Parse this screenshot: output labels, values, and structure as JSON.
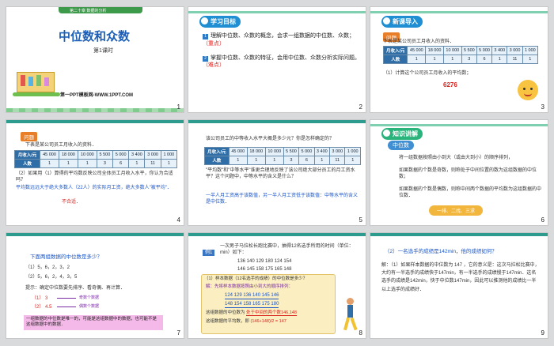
{
  "slides": [
    {
      "num": "1",
      "banner": "第二十章 数据的分析",
      "title": "中位数和众数",
      "sub": "第1课时",
      "footer": "第一PPT模板网-WWW.1PPT.COM"
    },
    {
      "num": "2",
      "heading": "学习目标",
      "goal1_a": "理解中位数、众数的概念，会求一组数据的中位数、众数；",
      "goal1_b": "（重点）",
      "goal2_a": "掌握中位数、众数的特征，会用中位数、众数分析实际问题。",
      "goal2_b": "（难点）"
    },
    {
      "num": "3",
      "heading": "新课导入",
      "tag": "问题",
      "intro": "下表是某公司员工月收入的资料．",
      "q": "（1）计算这个公司员工月收入的平均数；",
      "answer": "6276"
    },
    {
      "num": "4",
      "tag": "问题",
      "intro": "下表是某公司员工月收入的资料．",
      "q2": "（2）如果用（1）算得的平均数反映公司全体员工月收入水平，你认为合适吗？",
      "a2": "平均数远远大于绝大多数人（22人）的实际月工资，绝大多数人\"被平均\"．",
      "a2b": "不合适．"
    },
    {
      "num": "5",
      "q": "该公司员工的中等收入水平大概是多少元？你是怎样确定的？",
      "p1": "\"平均数\"和\"中等水平\"谁更合理地反映了该公司绝大部分员工的月工资水平？这个问题中，中等水平的含义是什么？",
      "p2": "一半人月工资高于该数值，另一半人月工资低于该数值：中等水平的含义是中位数．"
    },
    {
      "num": "6",
      "heading": "知识讲解",
      "sub": "中位数",
      "l1": "将一组数据按照由小到大（或由大到小）的顺序排列，",
      "l2": "如果数据的个数是奇数，则称处于中间位置的数为这组数据的中位数；",
      "l3": "如果数据的个数是偶数，则称中间两个数据的平均数为这组数据的中位数．",
      "pill": "一排、二找、三求"
    },
    {
      "num": "7",
      "head": "下面两组数据的中位数是多少？",
      "d1": "（1）5，6，2，3，2",
      "d2": "（2）5，6，2，4，3，5",
      "tip": "提示：确定中位数要先排序、看奇偶、再计算．",
      "r1": "（1）  3",
      "r2": "（2）  4.5",
      "n1": "奇数个数据",
      "n2": "偶数个数据",
      "box": "一组数据的中位数是唯一的，可能是这组数据中的数据，也可能不是这组数据中的数据．"
    },
    {
      "num": "8",
      "tag": "例1",
      "intro": "一次男子马拉松长跑比赛中，抽得12名选手所用的时间（单位：min）如下：",
      "row1": "136  140  129  180  124  154",
      "row2": "146  145  158  175  165  148",
      "q": "（1）样本数据（12名选手的成绩）的中位数是多少？",
      "sol": "解：先将样本数据按照由小到大的顺序排列：",
      "s1": "124  129  136  140  145  146",
      "s2": "148  154  158  165  175  180",
      "c1": "这组数据的中位数为",
      "c1b": "处于中间的两个数146,148",
      "c2": "这组数据的平均数，即",
      "frac": "(146+148)/2 = 147"
    },
    {
      "num": "9",
      "q": "（2）一名选手的成绩是142min，他的成绩如何？",
      "ans": "解：（1）如果样本数据的中位数为 147 ，它的意义是：这次马拉松比赛中，大约有一半选手的成绩快于147min，有一半选手的成绩慢于147min．这名选手的成绩是142min，快于中位数147min，因此可以推测他的成绩比一半以上选手的成绩好．"
    }
  ],
  "table": {
    "header": "月收入/元",
    "cols": [
      "45 000",
      "18 000",
      "10 000",
      "5 500",
      "5 000",
      "3 400",
      "3 000",
      "1 000"
    ],
    "rowlabel": "人数",
    "counts": [
      "1",
      "1",
      "1",
      "3",
      "6",
      "1",
      "11",
      "1"
    ]
  }
}
